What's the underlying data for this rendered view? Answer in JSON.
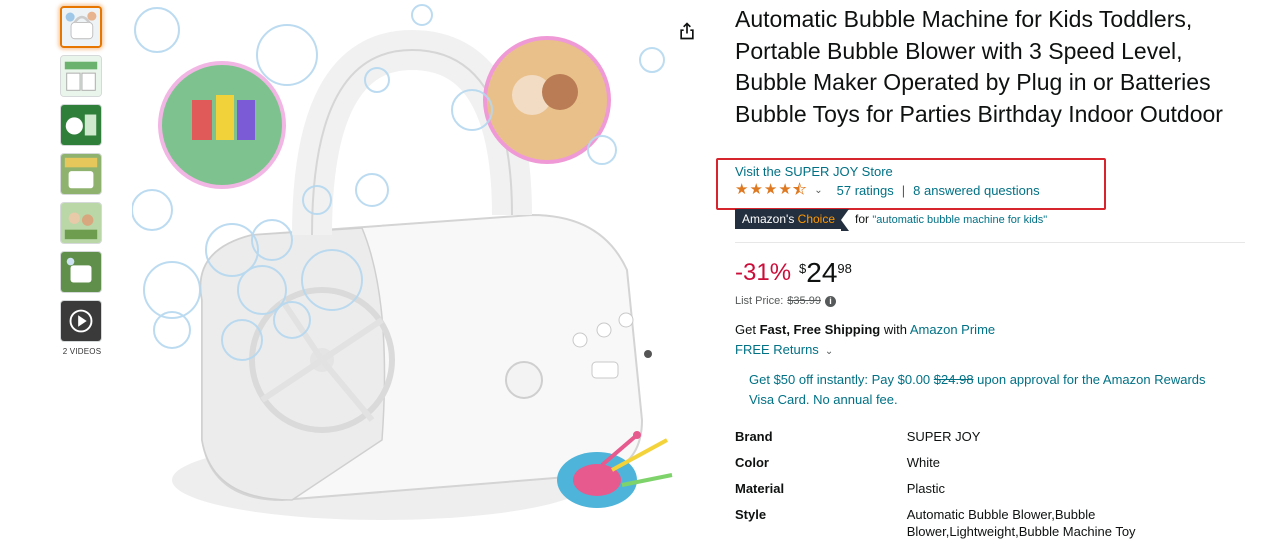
{
  "thumbnails": [
    {
      "name": "thumb-1",
      "active": true
    },
    {
      "name": "thumb-2",
      "active": false
    },
    {
      "name": "thumb-3",
      "active": false
    },
    {
      "name": "thumb-4",
      "active": false
    },
    {
      "name": "thumb-5",
      "active": false
    },
    {
      "name": "thumb-6",
      "active": false
    },
    {
      "name": "thumb-video",
      "active": false
    }
  ],
  "videos_label": "2 VIDEOS",
  "product": {
    "title": "Automatic Bubble Machine for Kids Toddlers, Portable Bubble Blower with 3 Speed Level, Bubble Maker Operated by Plug in or Batteries Bubble Toys for Parties Birthday Indoor Outdoor",
    "store_link": "Visit the SUPER JOY Store",
    "rating_value": 4.5,
    "ratings_text": "57 ratings",
    "answered_text": "8 answered questions",
    "choice_badge_a": "Amazon's",
    "choice_badge_b": "Choice",
    "choice_for": "for",
    "choice_term": "\"automatic bubble machine for kids\"",
    "discount": "-31%",
    "price_symbol": "$",
    "price_whole": "24",
    "price_fraction": "98",
    "list_price_label": "List Price:",
    "list_price": "$35.99",
    "shipping_get": "Get",
    "shipping_fast": "Fast, Free Shipping",
    "shipping_with": "with",
    "shipping_prime": "Amazon Prime",
    "free_returns": "FREE Returns",
    "promo_a": "Get $50 off instantly: Pay $0.00",
    "promo_strike": "$24.98",
    "promo_b": "upon approval for the Amazon Rewards Visa Card. No annual fee."
  },
  "specs": [
    {
      "key": "Brand",
      "value": "SUPER JOY"
    },
    {
      "key": "Color",
      "value": "White"
    },
    {
      "key": "Material",
      "value": "Plastic"
    },
    {
      "key": "Style",
      "value": "Automatic Bubble Blower,Bubble Blower,Lightweight,Bubble Machine Toy"
    }
  ],
  "colors": {
    "link": "#007185",
    "star": "#de7921",
    "discount": "#cc0c39",
    "highlight": "#d6252c",
    "badge_bg": "#232f3e",
    "badge_accent": "#ff9900"
  }
}
